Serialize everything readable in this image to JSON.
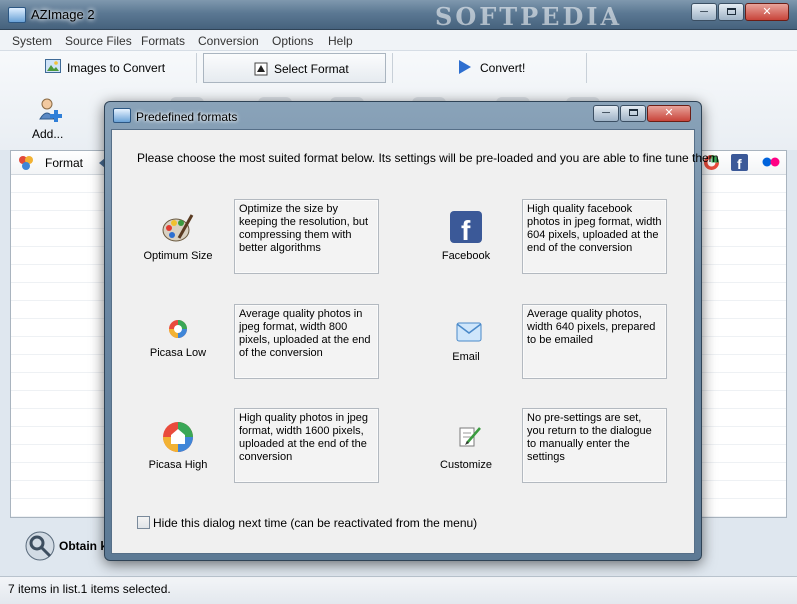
{
  "window": {
    "title": "AZImage 2",
    "watermark": "SOFTPEDIA",
    "minimize_glyph": "─",
    "close_glyph": "✕"
  },
  "menu": [
    "System",
    "Source Files",
    "Formats",
    "Conversion",
    "Options",
    "Help"
  ],
  "toolbar": {
    "images_to_convert": "Images to Convert",
    "select_format": "Select Format",
    "convert": "Convert!",
    "add": "Add..."
  },
  "list": {
    "header_format": "Format"
  },
  "bottom": {
    "obtain_label": "Obtain k"
  },
  "status": {
    "text": "7 items in list.1 items selected."
  },
  "dialog": {
    "title": "Predefined formats",
    "intro": "Please choose the most suited format below. Its settings will be pre-loaded and you are able to fine tune them",
    "options": [
      {
        "label": "Optimum Size",
        "icon": "palette-icon",
        "description": "Optimize the size by keeping the resolution, but compressing them with better algorithms"
      },
      {
        "label": "Facebook",
        "icon": "facebook-icon",
        "description": "High quality facebook photos in jpeg format, width 604 pixels, uploaded at the end of the conversion"
      },
      {
        "label": "Picasa Low",
        "icon": "picasa-small-icon",
        "description": "Average quality photos in jpeg format, width 800 pixels, uploaded at the end of the conversion"
      },
      {
        "label": "Email",
        "icon": "email-icon",
        "description": "Average quality photos, width 640 pixels, prepared to be emailed"
      },
      {
        "label": "Picasa High",
        "icon": "picasa-large-icon",
        "description": "High quality photos in jpeg format, width 1600 pixels, uploaded at the end of the conversion"
      },
      {
        "label": "Customize",
        "icon": "customize-icon",
        "description": "No pre-settings are set, you return to the dialogue to manually enter the settings"
      }
    ],
    "hide_checkbox": "Hide this dialog next time (can be reactivated from the menu)",
    "hide_checked": false
  },
  "colors": {
    "facebook_blue": "#3b5998",
    "flickr_pink": "#ff0084",
    "flickr_blue": "#0063dc",
    "convert_arrow": "#2e6fd0"
  }
}
